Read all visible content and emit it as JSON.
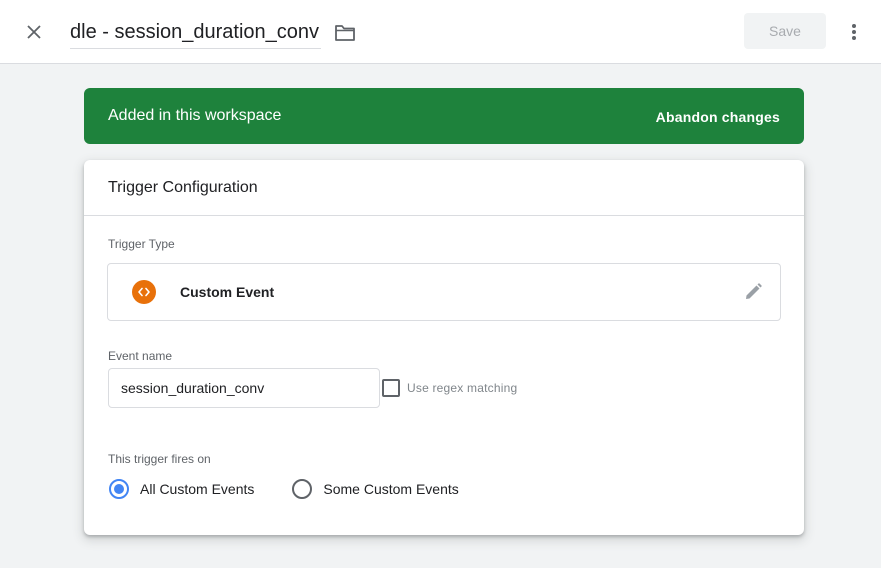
{
  "header": {
    "title": "dle - session_duration_conv",
    "close_icon": "close-icon",
    "folder_icon": "folder-icon",
    "save_label": "Save",
    "more_icon": "more-vert-icon"
  },
  "banner": {
    "text": "Added in this workspace",
    "action_label": "Abandon changes",
    "color": "#1e823c"
  },
  "card": {
    "title": "Trigger Configuration",
    "trigger_type": {
      "label": "Trigger Type",
      "value": "Custom Event",
      "icon": "code-brackets-icon",
      "icon_color": "#e8710a",
      "edit_icon": "pencil-icon"
    },
    "event_name": {
      "label": "Event name",
      "value": "session_duration_conv",
      "regex_label": "Use regex matching",
      "regex_checked": false
    },
    "fires_on": {
      "label": "This trigger fires on",
      "options": [
        {
          "label": "All Custom Events",
          "checked": true
        },
        {
          "label": "Some Custom Events",
          "checked": false
        }
      ],
      "accent": "#4285f4"
    }
  }
}
